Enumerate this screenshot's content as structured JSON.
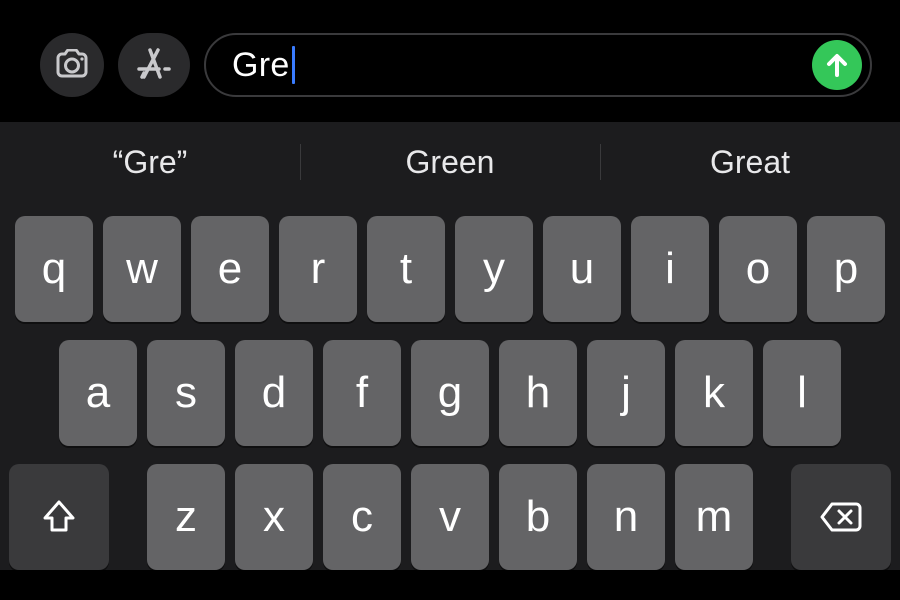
{
  "compose": {
    "input_value": "Gre",
    "send_color": "#34c759"
  },
  "suggestions": {
    "items": [
      "“Gre”",
      "Green",
      "Great"
    ]
  },
  "keyboard": {
    "row1": [
      "q",
      "w",
      "e",
      "r",
      "t",
      "y",
      "u",
      "i",
      "o",
      "p"
    ],
    "row2": [
      "a",
      "s",
      "d",
      "f",
      "g",
      "h",
      "j",
      "k",
      "l"
    ],
    "row3_letters": [
      "z",
      "x",
      "c",
      "v",
      "b",
      "n",
      "m"
    ]
  },
  "icons": {
    "camera": "camera-icon",
    "appstore": "appstore-icon",
    "send": "arrow-up-icon",
    "shift": "shift-icon",
    "backspace": "backspace-icon"
  }
}
